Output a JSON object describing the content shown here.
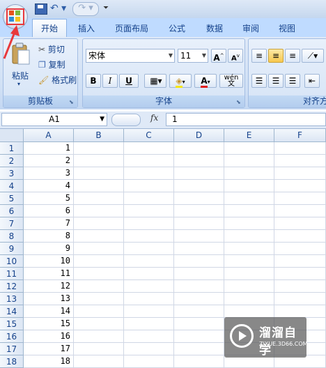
{
  "qat": {
    "undo": "↶ ▾",
    "redo": "↷ ▾",
    "customize": "⏷"
  },
  "tabs": [
    "开始",
    "插入",
    "页面布局",
    "公式",
    "数据",
    "审阅",
    "视图"
  ],
  "clipboard": {
    "paste": "粘贴",
    "cut": "剪切",
    "copy": "复制",
    "format_painter": "格式刷",
    "label": "剪贴板"
  },
  "font": {
    "name": "宋体",
    "size": "11",
    "bold": "B",
    "italic": "I",
    "underline": "U",
    "wen": "wén\n文",
    "label": "字体"
  },
  "alignment": {
    "label": "对齐方"
  },
  "formula_bar": {
    "name_box": "A1",
    "fx": "fx",
    "content": "1"
  },
  "columns": [
    "A",
    "B",
    "C",
    "D",
    "E",
    "F"
  ],
  "rows": [
    "1",
    "2",
    "3",
    "4",
    "5",
    "6",
    "7",
    "8",
    "9",
    "10",
    "11",
    "12",
    "13",
    "14",
    "15",
    "16",
    "17",
    "18"
  ],
  "col_a_values": [
    "1",
    "2",
    "3",
    "4",
    "5",
    "6",
    "7",
    "8",
    "9",
    "10",
    "11",
    "12",
    "13",
    "14",
    "15",
    "16",
    "17",
    "18"
  ],
  "watermark": {
    "title": "溜溜自学",
    "url": "ZIXUE.3D66.COM"
  },
  "colors": {
    "ribbon": "#d0e0f5",
    "tabbar": "#bfdbff",
    "highlight": "#e8393c"
  }
}
